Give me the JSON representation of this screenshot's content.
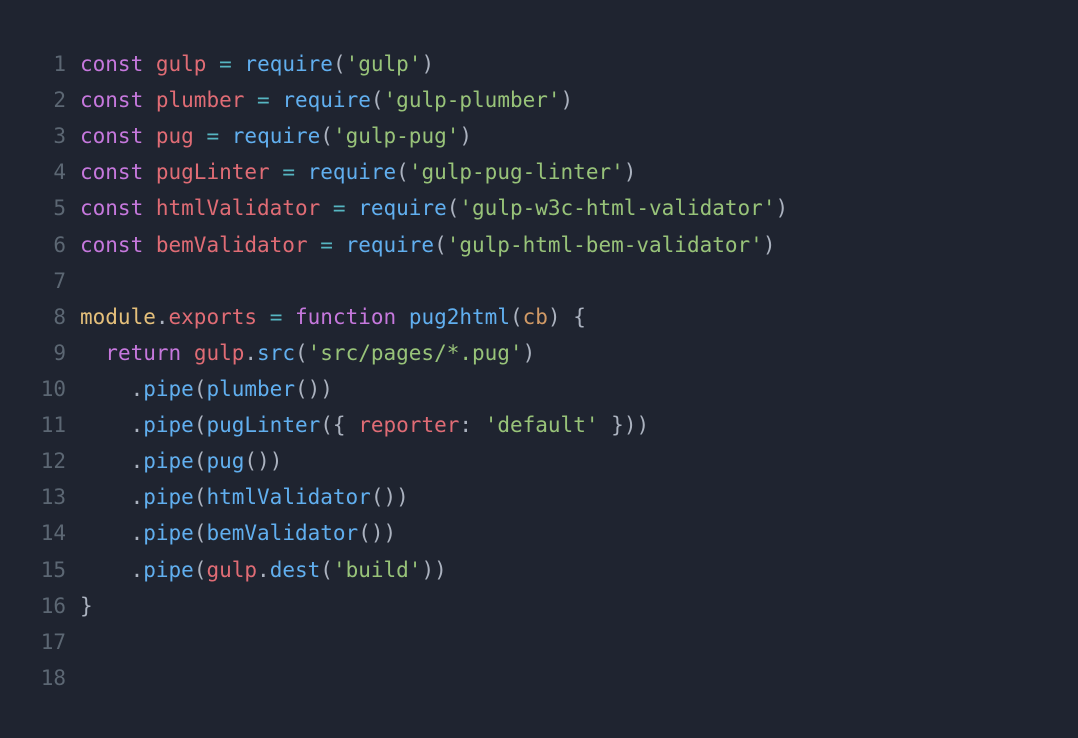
{
  "lines": [
    {
      "n": "1",
      "tokens": [
        [
          "kw",
          "const"
        ],
        [
          "",
          null,
          " "
        ],
        [
          "var",
          "gulp"
        ],
        [
          "",
          null,
          " "
        ],
        [
          "op",
          "="
        ],
        [
          "",
          null,
          " "
        ],
        [
          "fn",
          "require"
        ],
        [
          "punc",
          "("
        ],
        [
          "str",
          "'gulp'"
        ],
        [
          "punc",
          ")"
        ]
      ]
    },
    {
      "n": "2",
      "tokens": [
        [
          "kw",
          "const"
        ],
        [
          "",
          null,
          " "
        ],
        [
          "var",
          "plumber"
        ],
        [
          "",
          null,
          " "
        ],
        [
          "op",
          "="
        ],
        [
          "",
          null,
          " "
        ],
        [
          "fn",
          "require"
        ],
        [
          "punc",
          "("
        ],
        [
          "str",
          "'gulp-plumber'"
        ],
        [
          "punc",
          ")"
        ]
      ]
    },
    {
      "n": "3",
      "tokens": [
        [
          "kw",
          "const"
        ],
        [
          "",
          null,
          " "
        ],
        [
          "var",
          "pug"
        ],
        [
          "",
          null,
          " "
        ],
        [
          "op",
          "="
        ],
        [
          "",
          null,
          " "
        ],
        [
          "fn",
          "require"
        ],
        [
          "punc",
          "("
        ],
        [
          "str",
          "'gulp-pug'"
        ],
        [
          "punc",
          ")"
        ]
      ]
    },
    {
      "n": "4",
      "tokens": [
        [
          "kw",
          "const"
        ],
        [
          "",
          null,
          " "
        ],
        [
          "var",
          "pugLinter"
        ],
        [
          "",
          null,
          " "
        ],
        [
          "op",
          "="
        ],
        [
          "",
          null,
          " "
        ],
        [
          "fn",
          "require"
        ],
        [
          "punc",
          "("
        ],
        [
          "str",
          "'gulp-pug-linter'"
        ],
        [
          "punc",
          ")"
        ]
      ]
    },
    {
      "n": "5",
      "tokens": [
        [
          "kw",
          "const"
        ],
        [
          "",
          null,
          " "
        ],
        [
          "var",
          "htmlValidator"
        ],
        [
          "",
          null,
          " "
        ],
        [
          "op",
          "="
        ],
        [
          "",
          null,
          " "
        ],
        [
          "fn",
          "require"
        ],
        [
          "punc",
          "("
        ],
        [
          "str",
          "'gulp-w3c-html-validator'"
        ],
        [
          "punc",
          ")"
        ]
      ]
    },
    {
      "n": "6",
      "tokens": [
        [
          "kw",
          "const"
        ],
        [
          "",
          null,
          " "
        ],
        [
          "var",
          "bemValidator"
        ],
        [
          "",
          null,
          " "
        ],
        [
          "op",
          "="
        ],
        [
          "",
          null,
          " "
        ],
        [
          "fn",
          "require"
        ],
        [
          "punc",
          "("
        ],
        [
          "str",
          "'gulp-html-bem-validator'"
        ],
        [
          "punc",
          ")"
        ]
      ]
    },
    {
      "n": "7",
      "tokens": []
    },
    {
      "n": "8",
      "tokens": [
        [
          "obj",
          "module"
        ],
        [
          "punc",
          "."
        ],
        [
          "prop",
          "exports"
        ],
        [
          "",
          null,
          " "
        ],
        [
          "op",
          "="
        ],
        [
          "",
          null,
          " "
        ],
        [
          "kw",
          "function"
        ],
        [
          "",
          null,
          " "
        ],
        [
          "fn",
          "pug2html"
        ],
        [
          "punc",
          "("
        ],
        [
          "param",
          "cb"
        ],
        [
          "punc",
          ")"
        ],
        [
          "",
          null,
          " "
        ],
        [
          "punc",
          "{"
        ]
      ]
    },
    {
      "n": "9",
      "tokens": [
        [
          "",
          null,
          "  "
        ],
        [
          "kw",
          "return"
        ],
        [
          "",
          null,
          " "
        ],
        [
          "var",
          "gulp"
        ],
        [
          "punc",
          "."
        ],
        [
          "fn",
          "src"
        ],
        [
          "punc",
          "("
        ],
        [
          "str",
          "'src/pages/*.pug'"
        ],
        [
          "punc",
          ")"
        ]
      ]
    },
    {
      "n": "10",
      "tokens": [
        [
          "",
          null,
          "    "
        ],
        [
          "punc",
          "."
        ],
        [
          "fn",
          "pipe"
        ],
        [
          "punc",
          "("
        ],
        [
          "fn",
          "plumber"
        ],
        [
          "punc",
          "("
        ],
        [
          "punc",
          ")"
        ],
        [
          "punc",
          ")"
        ]
      ]
    },
    {
      "n": "11",
      "tokens": [
        [
          "",
          null,
          "    "
        ],
        [
          "punc",
          "."
        ],
        [
          "fn",
          "pipe"
        ],
        [
          "punc",
          "("
        ],
        [
          "fn",
          "pugLinter"
        ],
        [
          "punc",
          "("
        ],
        [
          "punc",
          "{"
        ],
        [
          "",
          null,
          " "
        ],
        [
          "key",
          "reporter"
        ],
        [
          "punc",
          ":"
        ],
        [
          "",
          null,
          " "
        ],
        [
          "str",
          "'default'"
        ],
        [
          "",
          null,
          " "
        ],
        [
          "punc",
          "}"
        ],
        [
          "punc",
          ")"
        ],
        [
          "punc",
          ")"
        ]
      ]
    },
    {
      "n": "12",
      "tokens": [
        [
          "",
          null,
          "    "
        ],
        [
          "punc",
          "."
        ],
        [
          "fn",
          "pipe"
        ],
        [
          "punc",
          "("
        ],
        [
          "fn",
          "pug"
        ],
        [
          "punc",
          "("
        ],
        [
          "punc",
          ")"
        ],
        [
          "punc",
          ")"
        ]
      ]
    },
    {
      "n": "13",
      "tokens": [
        [
          "",
          null,
          "    "
        ],
        [
          "punc",
          "."
        ],
        [
          "fn",
          "pipe"
        ],
        [
          "punc",
          "("
        ],
        [
          "fn",
          "htmlValidator"
        ],
        [
          "punc",
          "("
        ],
        [
          "punc",
          ")"
        ],
        [
          "punc",
          ")"
        ]
      ]
    },
    {
      "n": "14",
      "tokens": [
        [
          "",
          null,
          "    "
        ],
        [
          "punc",
          "."
        ],
        [
          "fn",
          "pipe"
        ],
        [
          "punc",
          "("
        ],
        [
          "fn",
          "bemValidator"
        ],
        [
          "punc",
          "("
        ],
        [
          "punc",
          ")"
        ],
        [
          "punc",
          ")"
        ]
      ]
    },
    {
      "n": "15",
      "tokens": [
        [
          "",
          null,
          "    "
        ],
        [
          "punc",
          "."
        ],
        [
          "fn",
          "pipe"
        ],
        [
          "punc",
          "("
        ],
        [
          "var",
          "gulp"
        ],
        [
          "punc",
          "."
        ],
        [
          "fn",
          "dest"
        ],
        [
          "punc",
          "("
        ],
        [
          "str",
          "'build'"
        ],
        [
          "punc",
          ")"
        ],
        [
          "punc",
          ")"
        ]
      ]
    },
    {
      "n": "16",
      "tokens": [
        [
          "punc",
          "}"
        ]
      ]
    },
    {
      "n": "17",
      "tokens": []
    },
    {
      "n": "18",
      "tokens": []
    }
  ]
}
